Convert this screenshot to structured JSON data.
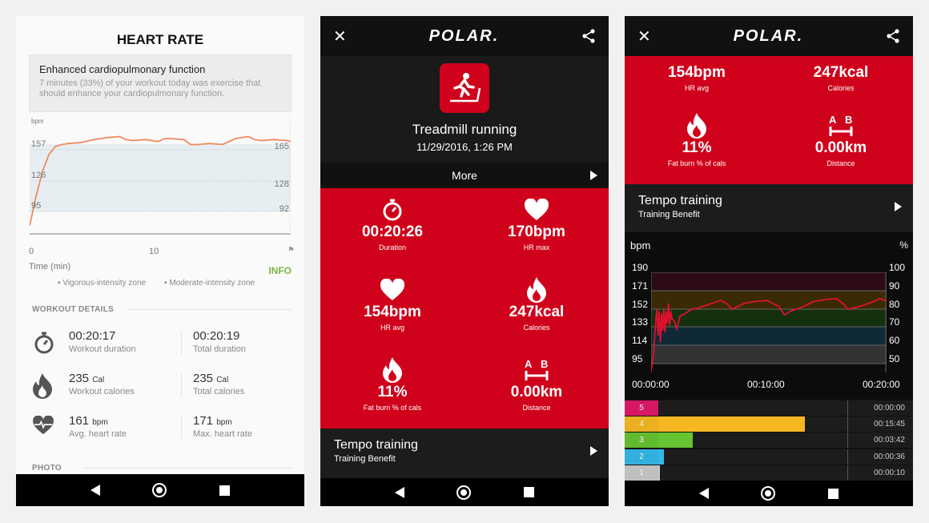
{
  "panel1": {
    "title": "HEART RATE",
    "card": {
      "title": "Enhanced cardiopulmonary function",
      "text": "7 minutes (33%) of your workout today was exercise that should enhance your cardiopulmonary function."
    },
    "chart": {
      "ylabel": "bpm",
      "yticks": [
        "157",
        "126",
        "95"
      ],
      "right_labels": [
        "165",
        "128",
        "92"
      ],
      "xticks": [
        "0",
        "10"
      ],
      "xlabel": "Time (min)",
      "info": "INFO",
      "legend": [
        "Vigorous-intensity zone",
        "Moderate-intensity zone"
      ],
      "line_color": "#f08a5d"
    },
    "details_header": "WORKOUT DETAILS",
    "details": [
      {
        "icon": "stopwatch-icon",
        "left": {
          "value": "00:20:17",
          "unit": "",
          "label": "Workout duration"
        },
        "right": {
          "value": "00:20:19",
          "unit": "",
          "label": "Total duration"
        }
      },
      {
        "icon": "flame-icon",
        "left": {
          "value": "235",
          "unit": "Cal",
          "label": "Workout calories"
        },
        "right": {
          "value": "235",
          "unit": "Cal",
          "label": "Total calories"
        }
      },
      {
        "icon": "heart-pulse-icon",
        "left": {
          "value": "161",
          "unit": "bpm",
          "label": "Avg. heart rate"
        },
        "right": {
          "value": "171",
          "unit": "bpm",
          "label": "Max. heart rate"
        }
      }
    ],
    "photo_header": "PHOTO"
  },
  "panel2": {
    "logo": "POLAR.",
    "sport": "Treadmill running",
    "date": "11/29/2016, 1:26 PM",
    "more": "More",
    "stats": [
      {
        "icon": "stopwatch-icon",
        "value": "00:20:26",
        "label": "Duration"
      },
      {
        "icon": "heart-icon",
        "value": "170bpm",
        "label": "HR max"
      },
      {
        "icon": "heart-icon",
        "value": "154bpm",
        "label": "HR avg"
      },
      {
        "icon": "flame-icon",
        "value": "247kcal",
        "label": "Calories"
      },
      {
        "icon": "flame-icon",
        "value": "11%",
        "label": "Fat burn % of cals"
      },
      {
        "icon": "distance-ab-icon",
        "value": "0.00km",
        "label": "Distance"
      }
    ],
    "benefit": {
      "title": "Tempo training",
      "subtitle": "Training Benefit"
    },
    "accent": "#d0021b"
  },
  "panel3": {
    "logo": "POLAR.",
    "stats": [
      {
        "value": "154bpm",
        "label": "HR avg"
      },
      {
        "value": "247kcal",
        "label": "Calories"
      },
      {
        "icon": "flame-icon",
        "value": "11%",
        "label": "Fat burn % of cals"
      },
      {
        "icon": "distance-ab-icon",
        "value": "0.00km",
        "label": "Distance"
      }
    ],
    "benefit": {
      "title": "Tempo training",
      "subtitle": "Training Benefit"
    },
    "chart": {
      "ylabel": "bpm",
      "y2label": "%",
      "yticks": [
        "190",
        "171",
        "152",
        "133",
        "114",
        "95"
      ],
      "y2ticks": [
        "100",
        "90",
        "80",
        "70",
        "60",
        "50"
      ],
      "xticks": [
        "00:00:00",
        "00:10:00",
        "00:20:00"
      ],
      "line_color": "#e0102f"
    },
    "zones": [
      {
        "zone": "5",
        "time": "00:00:00",
        "seconds": 0,
        "color": "#e0176b"
      },
      {
        "zone": "4",
        "time": "00:15:45",
        "seconds": 945,
        "color": "#f6b822"
      },
      {
        "zone": "3",
        "time": "00:03:42",
        "seconds": 222,
        "color": "#66c430"
      },
      {
        "zone": "2",
        "time": "00:00:36",
        "seconds": 36,
        "color": "#33b8e8"
      },
      {
        "zone": "1",
        "time": "00:00:10",
        "seconds": 10,
        "color": "#c8c8c8"
      }
    ]
  },
  "chart_data": [
    {
      "type": "line",
      "ylabel": "bpm",
      "xlabel": "Time (min)",
      "xlim": [
        0,
        20.3
      ],
      "ylim": [
        72,
        189
      ],
      "x": [
        0,
        0.5,
        1,
        1.5,
        2,
        2.5,
        3,
        4,
        5,
        6,
        7,
        7.5,
        8,
        9,
        10,
        10.5,
        11,
        12,
        12.5,
        13,
        14,
        15,
        16,
        17,
        17.5,
        18,
        19,
        20,
        20.3
      ],
      "y": [
        80,
        110,
        135,
        152,
        160,
        162,
        163,
        164,
        167,
        169,
        170,
        167,
        166,
        167,
        165,
        168,
        168,
        167,
        162,
        162,
        163,
        162,
        168,
        170,
        167,
        166,
        167,
        166,
        165
      ]
    },
    {
      "type": "line",
      "ylabel": "bpm",
      "xlim": [
        0,
        20.3
      ],
      "ylim": [
        87,
        190
      ],
      "x": [
        0,
        0.2,
        0.4,
        0.5,
        0.6,
        0.7,
        0.8,
        0.9,
        1,
        1.1,
        1.2,
        1.3,
        1.4,
        1.5,
        1.6,
        1.7,
        1.8,
        2,
        2.2,
        2.5,
        3,
        3.5,
        4,
        5,
        6,
        6.5,
        7,
        8,
        9,
        10,
        11,
        11.5,
        12,
        13,
        14,
        15,
        16,
        16.5,
        17,
        18,
        19,
        19.7,
        20,
        20.3
      ],
      "y": [
        88,
        105,
        140,
        152,
        125,
        150,
        118,
        148,
        130,
        152,
        128,
        150,
        137,
        158,
        135,
        150,
        142,
        140,
        132,
        145,
        148,
        152,
        153,
        157,
        161,
        158,
        152,
        158,
        160,
        161,
        155,
        146,
        150,
        154,
        160,
        162,
        163,
        158,
        152,
        155,
        159,
        163,
        162,
        160
      ]
    }
  ]
}
